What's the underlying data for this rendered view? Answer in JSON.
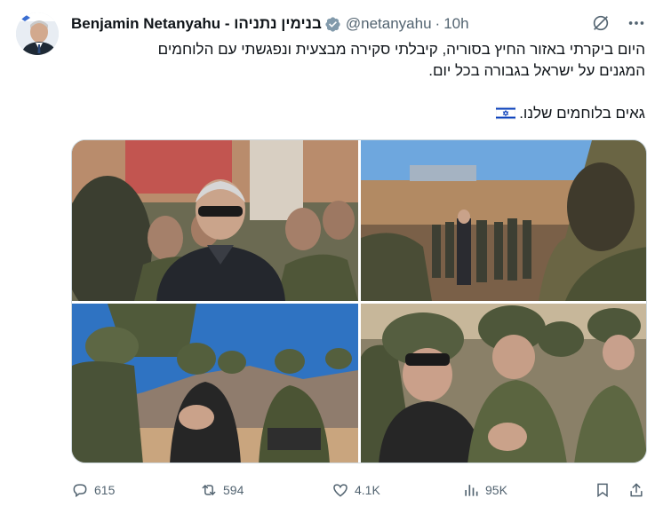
{
  "author": {
    "name": "Benjamin Netanyahu - בנימין נתניהו",
    "handle": "@netanyahu",
    "separator": "·",
    "time": "10h",
    "verified": true,
    "avatar_icon": "avatar-photo"
  },
  "post": {
    "line1": "היום ביקרתי באזור החיץ בסוריה, קיבלתי סקירה מבצעית ונפגשתי עם הלוחמים",
    "line2": "המגנים על ישראל בגבורה בכל יום.",
    "line3": "גאים בלוחמים שלנו.",
    "flag_icon": "israel-flag-icon"
  },
  "media": {
    "count": 4,
    "photos": [
      "photo-1",
      "photo-2",
      "photo-3",
      "photo-4"
    ]
  },
  "actions": {
    "replies": "615",
    "reposts": "594",
    "likes": "4.1K",
    "views": "95K"
  },
  "colors": {
    "text": "#0f1419",
    "secondary": "#536471",
    "verified_badge": "#829aab",
    "border": "#cfd9de",
    "flag_blue": "#0038b8"
  }
}
